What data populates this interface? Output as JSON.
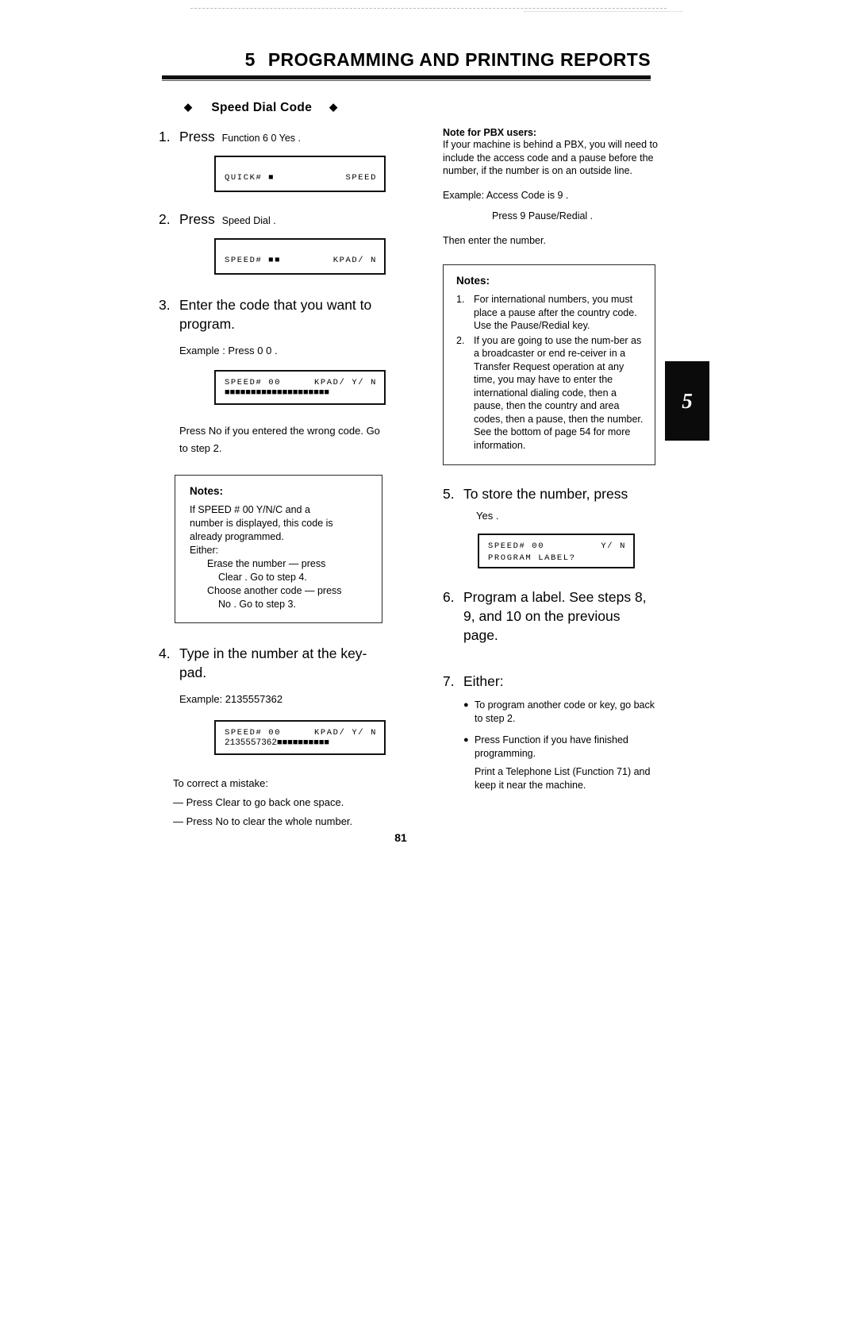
{
  "header": {
    "chapter_number": "5",
    "chapter_title": "PROGRAMMING AND PRINTING REPORTS"
  },
  "section": {
    "diamond_left": "◆",
    "diamond_right": "◆",
    "title": "Speed Dial Code"
  },
  "left_column": {
    "step1": {
      "number": "1.",
      "verb": "Press",
      "keys": "Function    6     0     Yes    .",
      "lcd": {
        "row1_left": "QUICK#  ■",
        "row1_right": "SPEED"
      }
    },
    "step2": {
      "number": "2.",
      "verb": "Press",
      "keys": "Speed Dial   .",
      "lcd": {
        "row1_left": "SPEED#  ■■",
        "row1_right": "KPAD/ N"
      }
    },
    "step3": {
      "number": "3.",
      "text": "Enter the code that you want to program.",
      "example": "Example : Press   0     0    .",
      "lcd": {
        "row1_left": "SPEED#  00",
        "row1_right": "KPAD/ Y/ N",
        "row2": "■■■■■■■■■■■■■■■■■■■■"
      },
      "after_text": "Press   No    if you entered the wrong code.  Go to step 2."
    },
    "notes": {
      "title": "Notes:",
      "line1": "If SPEED # 00    Y/N/C and a",
      "line2": "number is displayed, this code is",
      "line3": "already programmed.",
      "line4": "Either:",
      "line5": "Erase the number — press",
      "line6": "Clear   . Go to step 4.",
      "line7": "Choose another code — press",
      "line8": "No   . Go to step 3."
    },
    "step4": {
      "number": "4.",
      "text": "Type in the number at the key-pad.",
      "example": "Example: 2135557362",
      "lcd": {
        "row1_left": "SPEED#  00",
        "row1_right": "KPAD/ Y/ N",
        "row2_left": "2135557362",
        "row2_blocks": "■■■■■■■■■■"
      },
      "correct_title": "To correct a mistake:",
      "correct_line1": "— Press   Clear    to go back one space.",
      "correct_line2": "— Press   No    to clear the whole number."
    }
  },
  "right_column": {
    "pbx_note": {
      "title": "Note for PBX users:",
      "body": "If your machine is behind a PBX, you will need to include the access code and a pause before the number, if the number is on an outside line.",
      "example": "Example: Access Code is   9    .",
      "example_press": "Press   9     Pause/Redial    .",
      "then": "Then enter the number."
    },
    "notes": {
      "title": "Notes:",
      "items": [
        {
          "marker": "1.",
          "text": "For international numbers, you must place a pause after the country code.  Use the Pause/Redial key."
        },
        {
          "marker": "2.",
          "text": "If you are going to use the num-ber as a broadcaster or end re-ceiver in a Transfer Request operation at any time, you may have to enter the international dialing code, then a pause, then the country and area codes, then a pause, then the number.  See the bottom of page 54 for more information."
        }
      ]
    },
    "step5": {
      "number": "5.",
      "text": "To store the number, press",
      "key": "Yes    .",
      "lcd": {
        "row1_left": "SPEED#  00",
        "row1_right": "Y/ N",
        "row2": "PROGRAM LABEL?"
      }
    },
    "step6": {
      "number": "6.",
      "text": "Program a label.  See steps 8, 9, and 10 on the previous page."
    },
    "step7": {
      "number": "7.",
      "text": "Either:",
      "bullets": [
        "To program another code or key, go back to step 2.",
        "Press   Function    if you have finished programming."
      ],
      "trailing_line1": "Print a Telephone List (Function 71) and",
      "trailing_line2": "keep it near the machine."
    }
  },
  "thumb_tab": {
    "label": "5"
  },
  "page_number": "81"
}
